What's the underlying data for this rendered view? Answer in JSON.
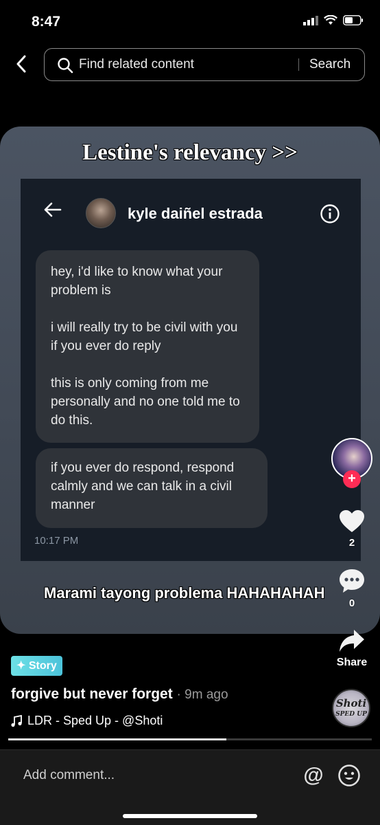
{
  "status_bar": {
    "time": "8:47"
  },
  "header": {
    "search_placeholder": "Find related content",
    "search_button": "Search"
  },
  "video": {
    "overlay_title": "Lestine's relevancy >>",
    "chat": {
      "contact_name": "kyle daiñel estrada",
      "message_1_lines": [
        "hey, i'd like to know what your problem is",
        "i will really try to be civil with you if you ever do reply",
        "this is only coming from me personally and no one told me to do this."
      ],
      "message_2": "if you ever do respond, respond calmly and we can talk in a civil manner",
      "timestamp": "10:17 PM"
    },
    "caption": "Marami tayong problema HAHAHAHAH"
  },
  "actions": {
    "like_count": "2",
    "comment_count": "0",
    "share_label": "Share"
  },
  "info": {
    "badge": "✦ Story",
    "description": "forgive but never forget",
    "time_ago": "· 9m ago",
    "music": "LDR - Sped Up - @Shoti",
    "music_disc_text_1": "Shoti",
    "music_disc_text_2": "SPED UP",
    "progress_percent": 60
  },
  "comment_bar": {
    "placeholder": "Add comment..."
  },
  "colors": {
    "follow_plus": "#fe2c55",
    "story_badge": "#4cc3da"
  }
}
